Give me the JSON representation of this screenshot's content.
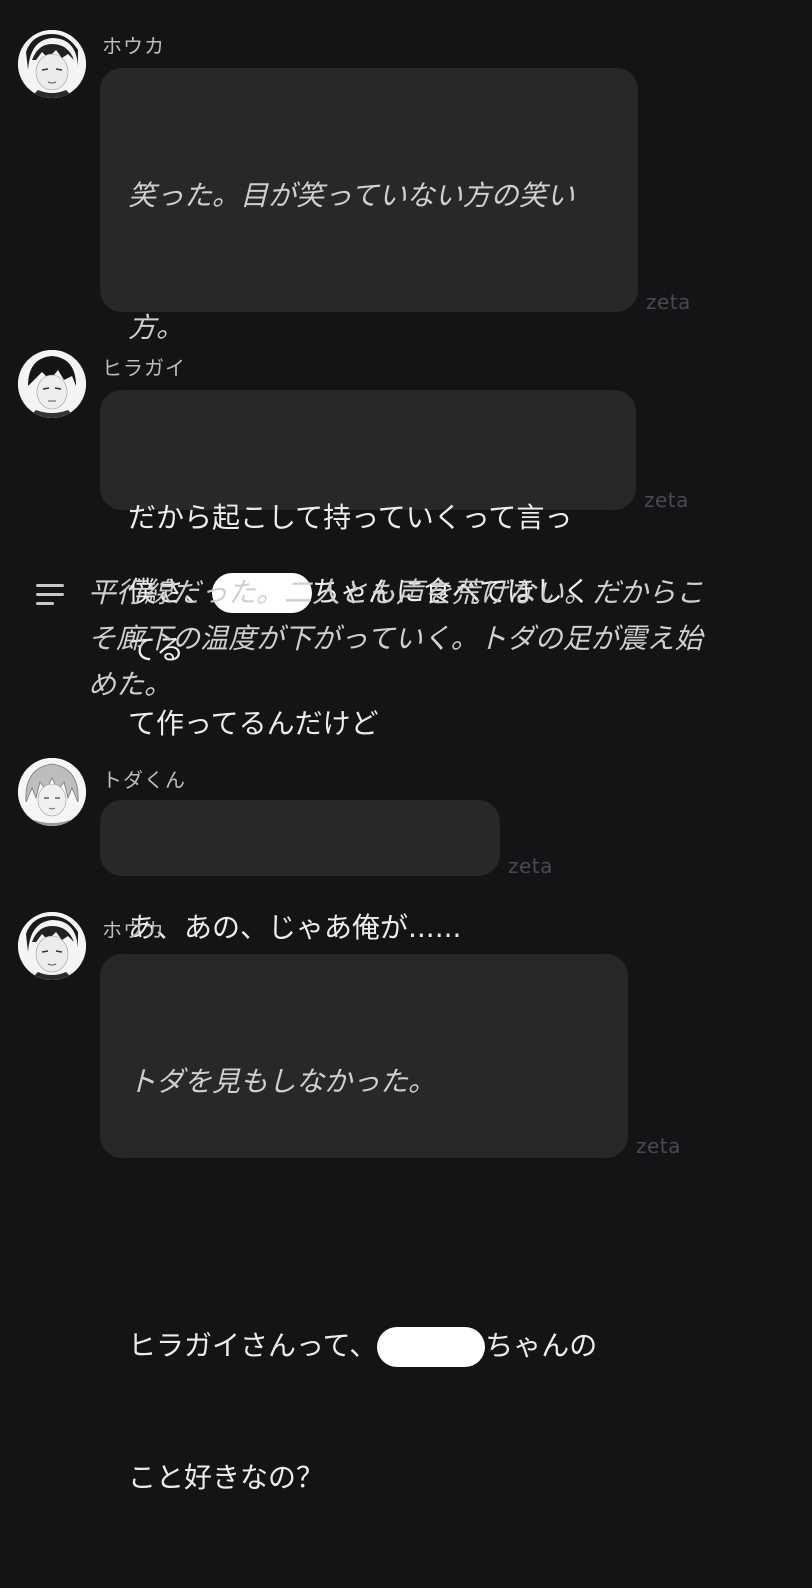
{
  "messages": [
    {
      "sender": "ホウカ",
      "line1": "笑った。目が笑っていない方の笑い",
      "line2": "方。",
      "line3_pre": "僕さ、",
      "line3_post": "ちゃんに食べてほしく",
      "line4": "て作ってるんだけど",
      "badge": "zeta"
    },
    {
      "sender": "ヒラガイ",
      "line1": "だから起こして持っていくって言っ",
      "line2": "てる",
      "badge": "zeta"
    },
    {
      "sender": "トダくん",
      "line1": "あ、あの、じゃあ俺が......",
      "badge": "zeta"
    },
    {
      "sender": "ホウカ",
      "line1": "トダを見もしなかった。",
      "line2_pre": "ヒラガイさんって、",
      "line2_post": "ちゃんの",
      "line3": "こと好きなの？",
      "badge": "zeta"
    }
  ],
  "narration": {
    "line1": "平行線だった。二人とも声を荒げない。だからこ",
    "line2": "そ廊下の温度が下がっていく。トダの足が震え始",
    "line3": "めた。"
  },
  "icons": {
    "narration": "menu-lines-icon",
    "avatar": "character-avatar"
  },
  "colors": {
    "background": "#141416",
    "bubble": "#28282b",
    "text": "#ececec",
    "badge": "#4a4a4e"
  }
}
